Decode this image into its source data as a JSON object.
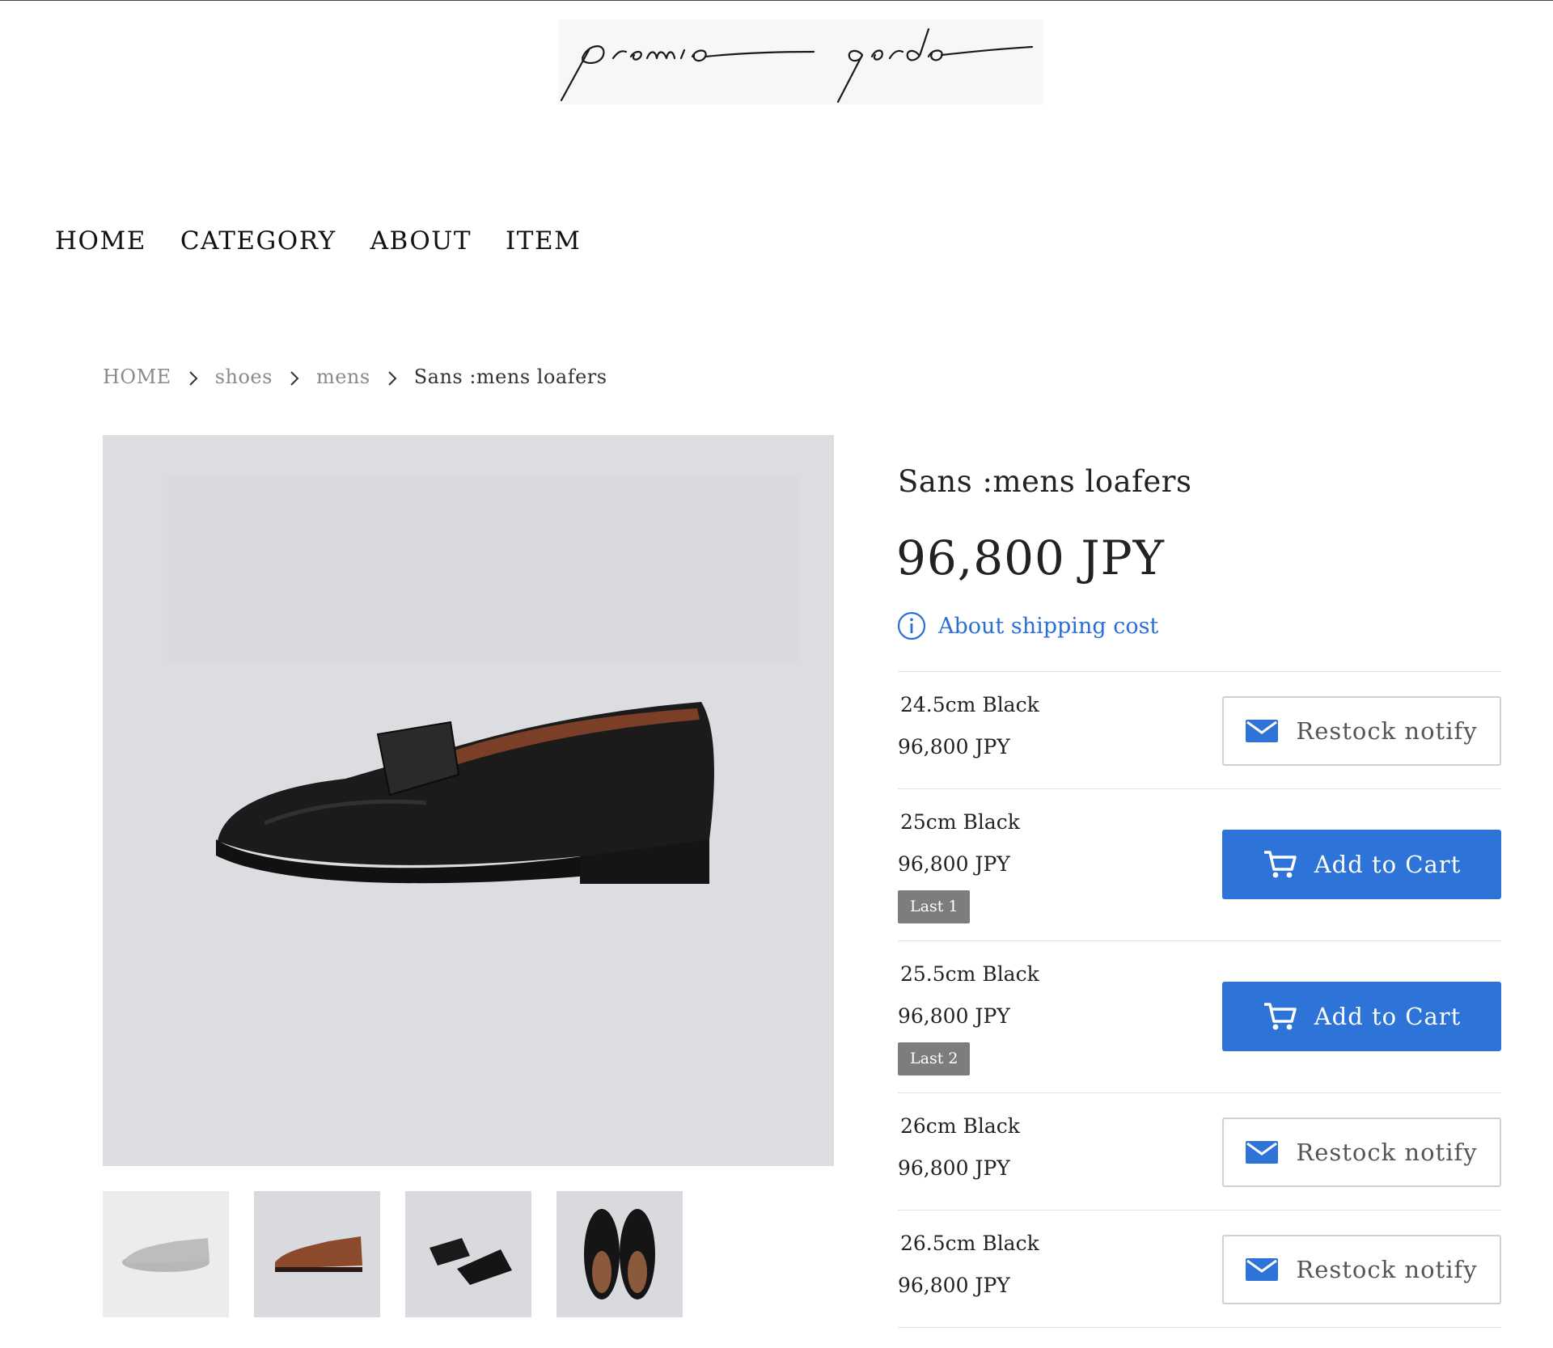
{
  "brand": {
    "logo_text": "premio gordo"
  },
  "nav": {
    "items": [
      {
        "label": "HOME"
      },
      {
        "label": "CATEGORY"
      },
      {
        "label": "ABOUT"
      },
      {
        "label": "ITEM"
      }
    ]
  },
  "breadcrumb": {
    "items": [
      {
        "label": "HOME"
      },
      {
        "label": "shoes"
      },
      {
        "label": "mens"
      },
      {
        "label": "Sans :mens loafers"
      }
    ]
  },
  "product": {
    "title": "Sans :mens loafers",
    "price": "96,800 JPY",
    "shipping_link": "About shipping cost",
    "variants": [
      {
        "name": "24.5cm Black",
        "price": "96,800 JPY",
        "badge": "",
        "button_label": "Restock notify",
        "button_type": "notify"
      },
      {
        "name": "25cm Black",
        "price": "96,800 JPY",
        "badge": "Last 1",
        "button_label": "Add to Cart",
        "button_type": "cart"
      },
      {
        "name": "25.5cm Black",
        "price": "96,800 JPY",
        "badge": "Last 2",
        "button_label": "Add to Cart",
        "button_type": "cart"
      },
      {
        "name": "26cm Black",
        "price": "96,800 JPY",
        "badge": "",
        "button_label": "Restock notify",
        "button_type": "notify"
      },
      {
        "name": "26.5cm Black",
        "price": "96,800 JPY",
        "badge": "",
        "button_label": "Restock notify",
        "button_type": "notify"
      }
    ]
  },
  "gallery": {
    "thumbnails": [
      {
        "name": "thumb-grey-loafer"
      },
      {
        "name": "thumb-brown-loafer"
      },
      {
        "name": "thumb-black-loafer-angle"
      },
      {
        "name": "thumb-black-loafers-top"
      }
    ]
  },
  "colors": {
    "accent": "#2e73d8",
    "link": "#2a6fd6",
    "badge": "#7d7d7d",
    "image_bg": "#dcdde0"
  },
  "icons": {
    "info": "info-icon",
    "mail": "mail-icon",
    "cart": "cart-icon",
    "chevron": "chevron-right-icon"
  }
}
